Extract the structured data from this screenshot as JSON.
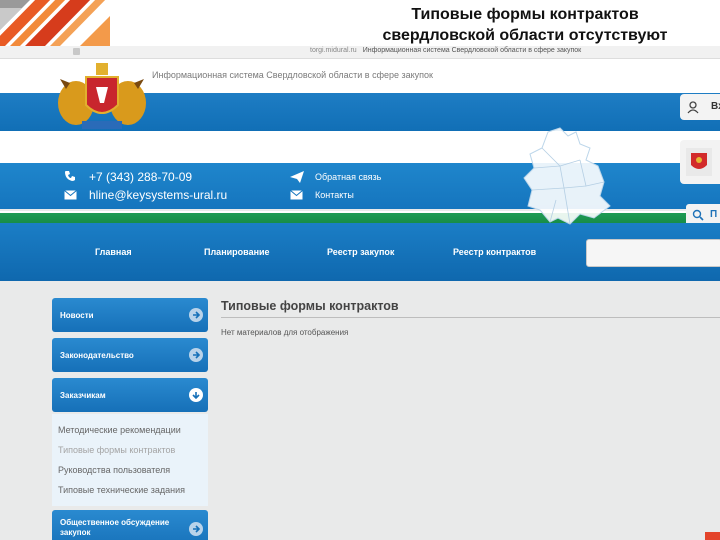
{
  "slide": {
    "title_line1": "Типовые формы контрактов",
    "title_line2": "свердловской области отсутствуют"
  },
  "browser": {
    "domain": "torgi.midural.ru",
    "page_title": "Информационная система Свердловской области в сфере закупок"
  },
  "header": {
    "system_name": "Информационная система Свердловской области в сфере закупок",
    "login_label": "Вх",
    "search_label": "П"
  },
  "contacts": {
    "phone": "+7 (343) 288-70-09",
    "email": "hline@keysystems-ural.ru",
    "feedback": "Обратная связь",
    "contacts_link": "Контакты"
  },
  "nav": {
    "items": [
      "Главная",
      "Планирование",
      "Реестр закупок",
      "Реестр контрактов"
    ]
  },
  "sidebar": {
    "items": [
      "Новости",
      "Законодательство",
      "Заказчикам"
    ],
    "sub_items": [
      "Методические рекомендации",
      "Типовые формы контрактов",
      "Руководства пользователя",
      "Типовые технические задания"
    ],
    "last_item_line1": "Общественное обсуждение",
    "last_item_line2": "закупок"
  },
  "content": {
    "title": "Типовые формы контрактов",
    "empty_message": "Нет материалов для отображения"
  },
  "colors": {
    "accent_blue": "#1575be",
    "accent_green": "#168a45",
    "slide_orange": "#f0732c"
  }
}
